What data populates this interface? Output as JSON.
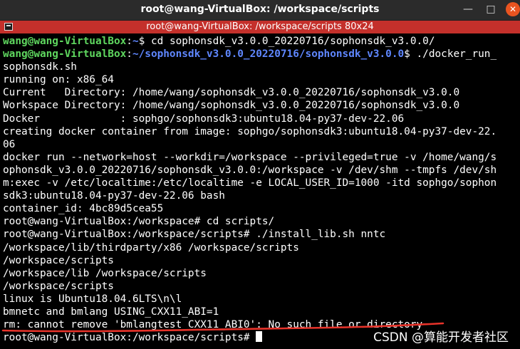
{
  "window": {
    "title": "root@wang-VirtualBox: /workspace/scripts",
    "minimize_glyph": "—",
    "maximize_glyph": "□",
    "close_glyph": "✕"
  },
  "tab": {
    "title": "root@wang-VirtualBox: /workspace/scripts 80x24"
  },
  "terminal": {
    "line1": {
      "user": "wang@wang-VirtualBox",
      "colon": ":",
      "path": "~",
      "cmd": "$ cd sophonsdk_v3.0.0_20220716/sophonsdk_v3.0.0/"
    },
    "line2": {
      "user": "wang@wang-VirtualBox",
      "colon": ":",
      "path": "~/sophonsdk_v3.0.0_20220716/sophonsdk_v3.0.0",
      "cmd": "$ ./docker_run_"
    },
    "line3": "sophonsdk.sh",
    "line4": "running on: x86_64",
    "line5": "Current   Directory: /home/wang/sophonsdk_v3.0.0_20220716/sophonsdk_v3.0.0",
    "line6": "Workspace Directory: /home/wang/sophonsdk_v3.0.0_20220716/sophonsdk_v3.0.0",
    "line7": "Docker             : sophgo/sophonsdk3:ubuntu18.04-py37-dev-22.06",
    "line8": "creating docker container from image: sophgo/sophonsdk3:ubuntu18.04-py37-dev-22.",
    "line9": "06",
    "line10": "docker run --network=host --workdir=/workspace --privileged=true -v /home/wang/s",
    "line11": "ophonsdk_v3.0.0_20220716/sophonsdk_v3.0.0:/workspace -v /dev/shm --tmpfs /dev/sh",
    "line12": "m:exec -v /etc/localtime:/etc/localtime -e LOCAL_USER_ID=1000 -itd sophgo/sophon",
    "line13": "sdk3:ubuntu18.04-py37-dev-22.06 bash",
    "line14": "container_id: 4bc89d5cea55",
    "line15": "root@wang-VirtualBox:/workspace# cd scripts/",
    "line16": "root@wang-VirtualBox:/workspace/scripts# ./install_lib.sh nntc",
    "line17": "/workspace/lib/thirdparty/x86 /workspace/scripts",
    "line18": "/workspace/scripts",
    "line19": "/workspace/lib /workspace/scripts",
    "line20": "/workspace/scripts",
    "line21": "linux is Ubuntu18.04.6LTS\\n\\l",
    "line22": "bmnetc and bmlang USING_CXX11_ABI=1",
    "line23": "rm: cannot remove 'bmlangtest_CXX11_ABI0': No such file or directory",
    "line24": "root@wang-VirtualBox:/workspace/scripts# "
  },
  "watermark": "CSDN @算能开发者社区",
  "colors": {
    "terminal_bg": "#000000",
    "prompt_user": "#5fd75f",
    "prompt_path": "#5f87ff",
    "tab_bar": "#c4302b",
    "close_button": "#e95420",
    "annotation_underline": "#e8332a"
  }
}
